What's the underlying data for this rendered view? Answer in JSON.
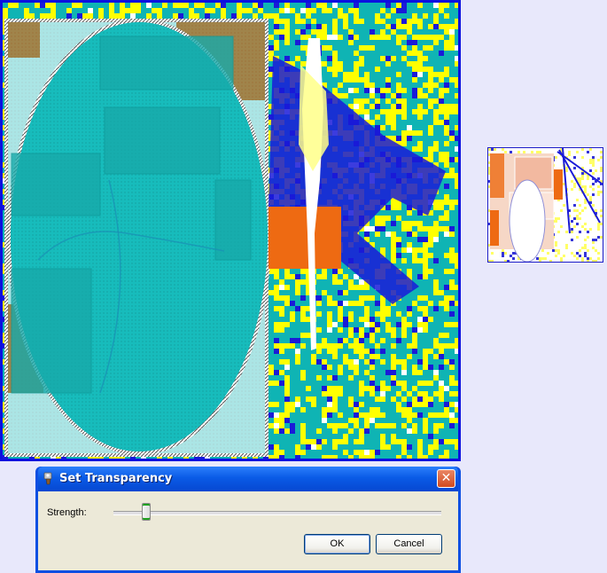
{
  "dialog": {
    "title": "Set Transparency",
    "close_label": "✕",
    "strength_label": "Strength:",
    "strength": 0.1,
    "ok_label": "OK",
    "cancel_label": "Cancel"
  },
  "colors": {
    "canvas_border": "#0b10e0",
    "teal": "#0fb4b4",
    "yellow": "#ffff00",
    "blue": "#1a1ad8",
    "orange": "#ee6a12",
    "oval_tint": "#1ec3c3",
    "titlebar": "#0a5be6",
    "dialog_face": "#ece9d8"
  },
  "icons": {
    "app": "paint-brush-icon",
    "close": "close-icon",
    "thumb": "slider-thumb"
  }
}
